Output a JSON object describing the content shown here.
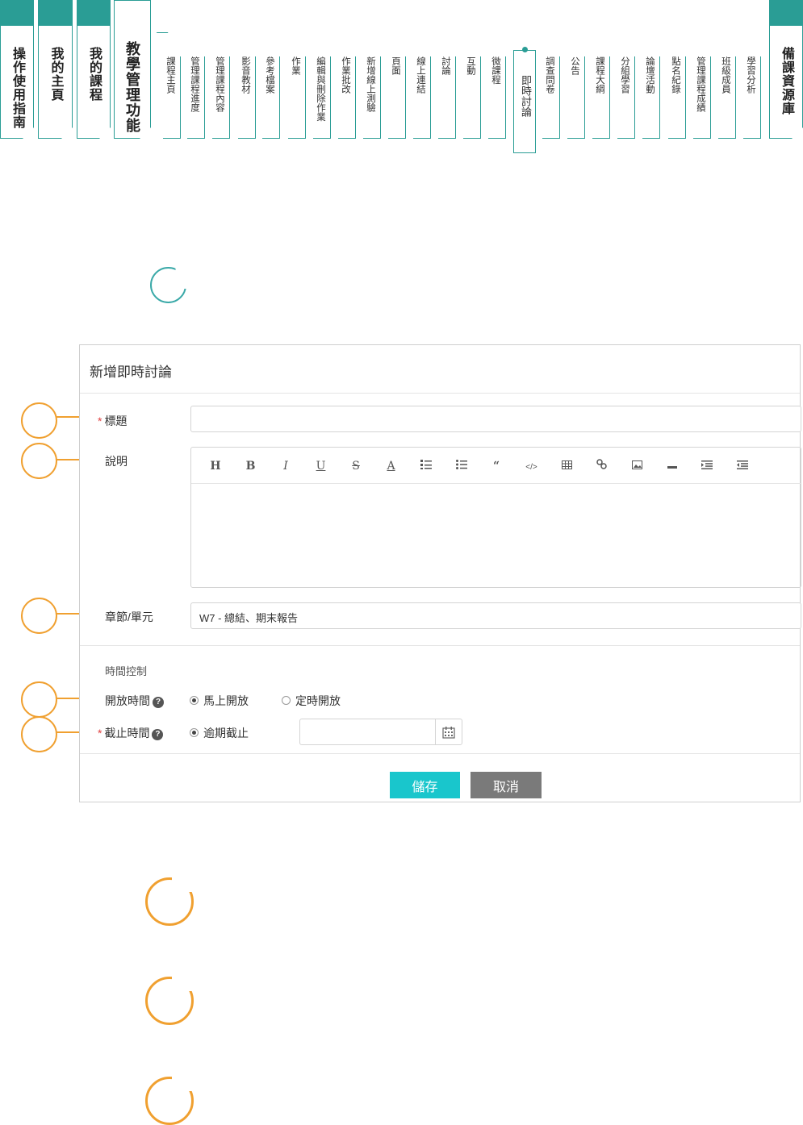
{
  "nav": {
    "main_tabs": [
      "操作使用指南",
      "我的主頁",
      "我的課程",
      "教學管理功能"
    ],
    "sub_tabs": [
      "課程主頁",
      "管理課程進度",
      "管理課程內容",
      "影音教材",
      "參考檔案",
      "作業",
      "編輯與刪除作業",
      "作業批改",
      "新增線上測驗",
      "頁面",
      "線上連結",
      "討論",
      "互動",
      "微課程",
      "即時討論",
      "調查問卷",
      "公告",
      "課程大綱",
      "分組學習",
      "論壇活動",
      "點名紀錄",
      "管理課程成績",
      "班級成員",
      "學習分析"
    ],
    "right_tab": "備課資源庫",
    "active_sub": "即時討論"
  },
  "dialog": {
    "title": "新增即時討論",
    "title_label": "標題",
    "description_label": "說明",
    "chapter_label": "章節/單元",
    "chapter_value": "W7 - 總結、期末報告",
    "time_control": "時間控制",
    "open_time_label": "開放時間",
    "open_now": "馬上開放",
    "open_scheduled": "定時開放",
    "deadline_label": "截止時間",
    "deadline_overdue": "逾期截止",
    "save": "儲存",
    "cancel": "取消"
  },
  "toolbar_icons": [
    "heading-icon",
    "bold-icon",
    "italic-icon",
    "underline-icon",
    "strikethrough-icon",
    "font-color-icon",
    "ordered-list-icon",
    "unordered-list-icon",
    "quote-icon",
    "code-icon",
    "table-icon",
    "link-icon",
    "image-icon",
    "horizontal-rule-icon",
    "indent-icon",
    "outdent-icon"
  ],
  "colors": {
    "nav_teal": "#2a9d95",
    "marker_orange": "#f0a030",
    "save_cyan": "#19c6cc",
    "cancel_gray": "#7a7a7a",
    "required_red": "#e04040"
  }
}
